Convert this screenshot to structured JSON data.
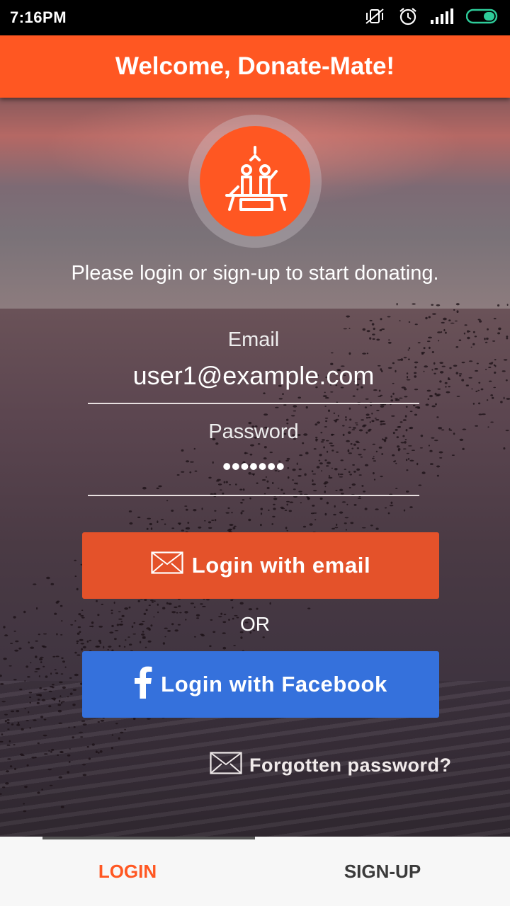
{
  "status_bar": {
    "time": "7:16PM",
    "icons": [
      "vibrate-off-icon",
      "alarm-icon",
      "signal-icon",
      "battery-icon"
    ]
  },
  "app_bar": {
    "title": "Welcome, Donate-Mate!"
  },
  "logo": {
    "icon": "donate-logo-icon"
  },
  "intro_text": "Please login or sign-up to start donating.",
  "email": {
    "label": "Email",
    "value": "user1@example.com"
  },
  "password": {
    "label": "Password",
    "value": "•••••••"
  },
  "buttons": {
    "login_email": "Login with email",
    "or": "OR",
    "login_facebook": "Login with Facebook",
    "forgot_password": "Forgotten password?"
  },
  "tabs": [
    {
      "label": "LOGIN",
      "active": true
    },
    {
      "label": "SIGN-UP",
      "active": false
    }
  ],
  "colors": {
    "accent": "#ff5722",
    "facebook": "#3571dc",
    "email_button": "#e4522a"
  }
}
